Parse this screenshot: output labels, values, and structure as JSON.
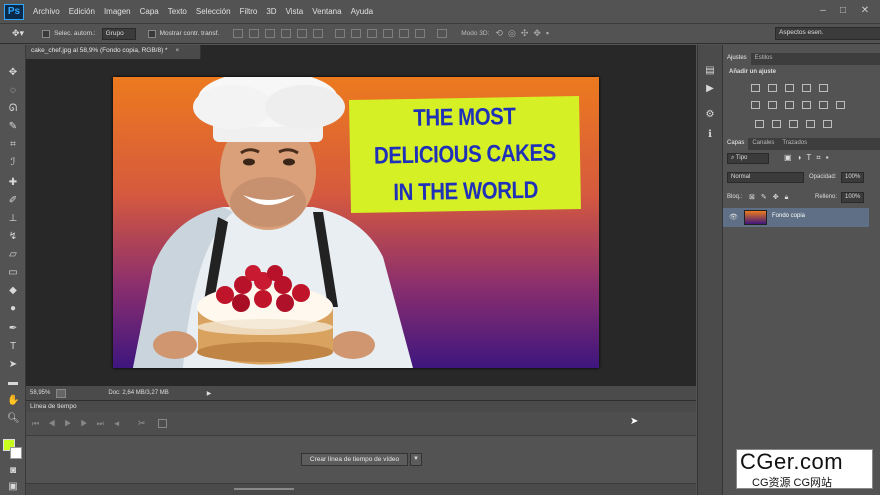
{
  "app": {
    "logo": "Ps",
    "menu": [
      "Archivo",
      "Edición",
      "Imagen",
      "Capa",
      "Texto",
      "Selección",
      "Filtro",
      "3D",
      "Vista",
      "Ventana",
      "Ayuda"
    ],
    "window_controls": [
      "–",
      "□",
      "✕"
    ]
  },
  "options": {
    "auto_select_label": "Selec. autom.:",
    "auto_select_value": "Grupo",
    "show_transform_label": "Mostrar contr. transf.",
    "mode3d_label": "Modo 3D:",
    "workspace": "Aspectos esen."
  },
  "document": {
    "tab_title": "cake_chef.jpg al 58,9% (Fondo copia, RGB/8) *",
    "headline": [
      "THE MOST",
      "DELICIOUS CAKES",
      "IN THE WORLD"
    ],
    "zoom": "58,95%",
    "doc_info": "Doc: 2,64 MB/3,27 MB"
  },
  "timeline": {
    "title": "Línea de tiempo",
    "create_button": "Crear línea de tiempo de vídeo"
  },
  "panels": {
    "top_tabs": [
      "Ajustes",
      "Estilos"
    ],
    "adjust_title": "Añadir un ajuste",
    "layer_tabs": [
      "Capas",
      "Canales",
      "Trazados"
    ],
    "filter_kind": "Tipo",
    "blend_mode": "Normal",
    "opacity_label": "Opacidad:",
    "opacity_value": "100%",
    "lock_label": "Bloq.:",
    "fill_label": "Relleno:",
    "fill_value": "100%",
    "layers": [
      {
        "name": "Fondo copia"
      }
    ]
  },
  "watermark": {
    "main": "CGer.com",
    "sub": "CG资源 CG网站"
  }
}
